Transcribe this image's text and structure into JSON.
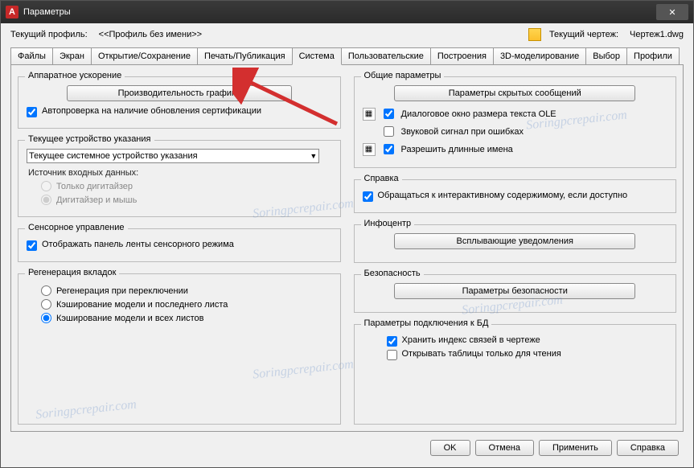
{
  "title": "Параметры",
  "profile_label": "Текущий профиль:",
  "profile_value": "<<Профиль без имени>>",
  "drawing_label": "Текущий чертеж:",
  "drawing_value": "Чертеж1.dwg",
  "tabs": {
    "files": "Файлы",
    "screen": "Экран",
    "opensave": "Открытие/Сохранение",
    "print": "Печать/Публикация",
    "system": "Система",
    "user": "Пользовательские",
    "drafting": "Построения",
    "modeling": "3D-моделирование",
    "select": "Выбор",
    "profiles": "Профили"
  },
  "left": {
    "hw_group": "Аппаратное ускорение",
    "perf_btn": "Производительность графики",
    "auto_check": "Автопроверка на наличие обновления сертификации",
    "device_group": "Текущее устройство указания",
    "device_select": "Текущее системное устройство указания",
    "source_label": "Источник входных данных:",
    "radio_digitizer": "Только дигитайзер",
    "radio_both": "Дигитайзер и мышь",
    "touch_group": "Сенсорное управление",
    "touch_check": "Отображать панель ленты сенсорного режима",
    "regen_group": "Регенерация вкладок",
    "radio_switch": "Регенерация при переключении",
    "radio_cache_last": "Кэширование модели и последнего листа",
    "radio_cache_all": "Кэширование модели и всех листов"
  },
  "right": {
    "general_group": "Общие параметры",
    "hidden_btn": "Параметры скрытых сообщений",
    "ole_check": "Диалоговое окно размера текста OLE",
    "beep_check": "Звуковой сигнал при ошибках",
    "long_names_check": "Разрешить длинные имена",
    "help_group": "Справка",
    "help_online_check": "Обращаться к интерактивному содержимому, если доступно",
    "infocenter_group": "Инфоцентр",
    "popup_btn": "Всплывающие уведомления",
    "security_group": "Безопасность",
    "security_btn": "Параметры безопасности",
    "db_group": "Параметры подключения к БД",
    "db_index_check": "Хранить индекс связей в чертеже",
    "db_readonly_check": "Открывать таблицы только для чтения"
  },
  "footer": {
    "ok": "OK",
    "cancel": "Отмена",
    "apply": "Применить",
    "help": "Справка"
  },
  "watermark": "Soringpcrepair.com"
}
